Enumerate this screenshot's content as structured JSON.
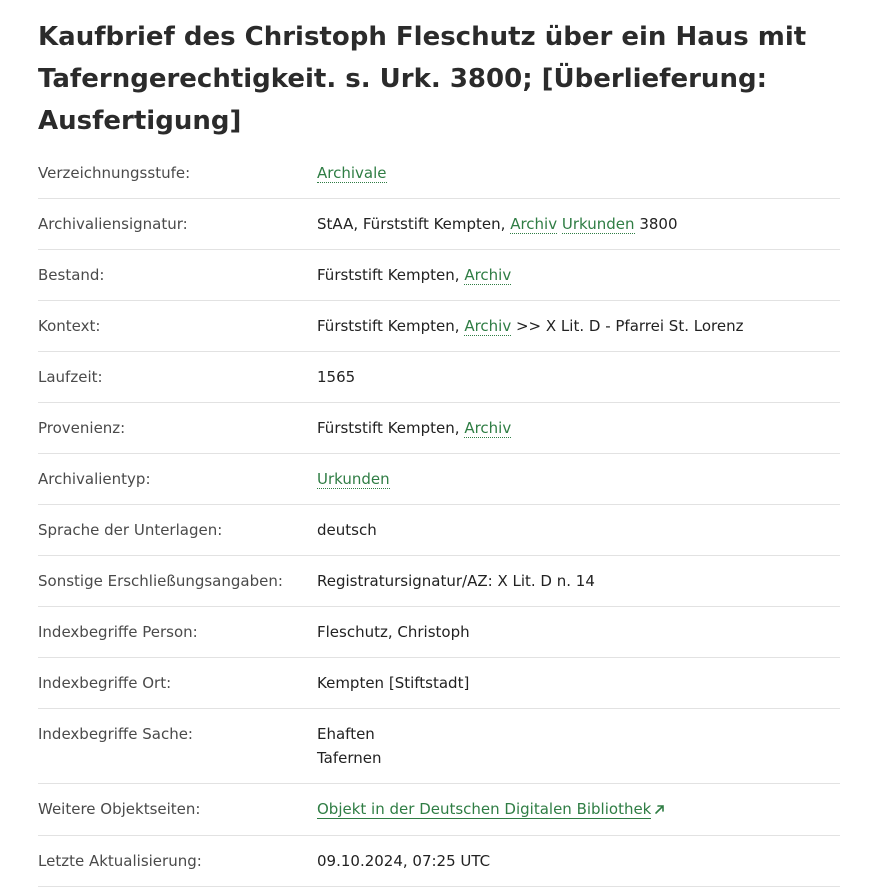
{
  "title": "Kaufbrief des Christoph Fleschutz über ein Haus mit Taferngerechtigkeit. s. Urk. 3800; [Überlieferung: Ausfertigung]",
  "rows": {
    "stufe": {
      "label": "Verzeichnungsstufe:",
      "link": "Archivale"
    },
    "signatur": {
      "label": "Archivaliensignatur:",
      "prefix": "StAA, Fürststift Kempten, ",
      "link1": "Archiv",
      "link2": "Urkunden",
      "suffix": " 3800"
    },
    "bestand": {
      "label": "Bestand:",
      "prefix": "Fürststift Kempten, ",
      "link": "Archiv"
    },
    "kontext": {
      "label": "Kontext:",
      "prefix": "Fürststift Kempten, ",
      "link": "Archiv",
      "suffix": " >> X Lit. D - Pfarrei St. Lorenz"
    },
    "laufzeit": {
      "label": "Laufzeit:",
      "value": "1565"
    },
    "provenienz": {
      "label": "Provenienz:",
      "prefix": "Fürststift Kempten, ",
      "link": "Archiv"
    },
    "typ": {
      "label": "Archivalientyp:",
      "link": "Urkunden"
    },
    "sprache": {
      "label": "Sprache der Unterlagen:",
      "value": "deutsch"
    },
    "sonstige": {
      "label": "Sonstige Erschließungsangaben:",
      "value": "Registratursignatur/AZ: X Lit. D n. 14"
    },
    "person": {
      "label": "Indexbegriffe Person:",
      "value": "Fleschutz, Christoph"
    },
    "ort": {
      "label": "Indexbegriffe Ort:",
      "value": "Kempten [Stiftstadt]"
    },
    "sache": {
      "label": "Indexbegriffe Sache:",
      "values": [
        "Ehaften",
        "Tafernen"
      ]
    },
    "weitere": {
      "label": "Weitere Objektseiten:",
      "link": "Objekt in der Deutschen Digitalen Bibliothek",
      "icon": "external-link-icon"
    },
    "aktualisierung": {
      "label": "Letzte Aktualisierung:",
      "value": "09.10.2024, 07:25 UTC"
    }
  },
  "colors": {
    "link": "#2f7d44",
    "divider": "#e2e2e2",
    "title": "#2b2b2b"
  }
}
